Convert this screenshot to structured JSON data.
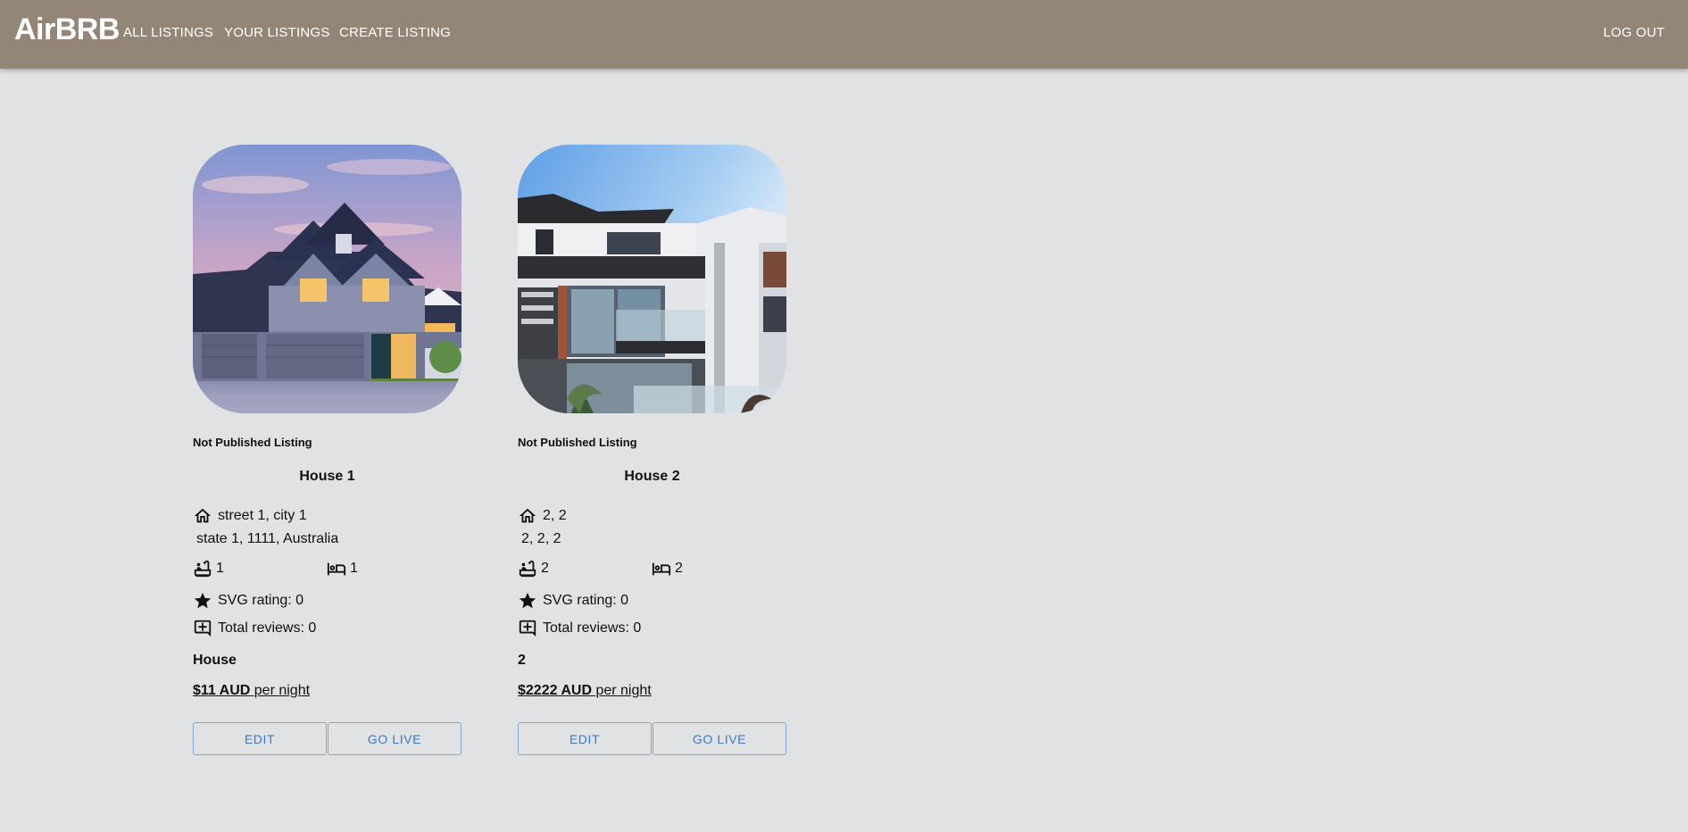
{
  "header": {
    "brand": "AirBRB",
    "nav": {
      "all_listings": "ALL LISTINGS",
      "your_listings": "YOUR LISTINGS",
      "create_listing": "CREATE LISTING",
      "logout": "LOG OUT"
    },
    "background": "#948677"
  },
  "listings": [
    {
      "status": "Not Published Listing",
      "title": "House 1",
      "address_line1": "street 1, city 1",
      "address_line2": "state 1, 1111, Australia",
      "bathrooms": "1",
      "bedrooms": "1",
      "rating_label": "SVG rating: 0",
      "reviews_label": "Total reviews: 0",
      "property_type": "House",
      "price_amount": "$11 AUD",
      "price_suffix": " per night",
      "edit_label": "EDIT",
      "go_live_label": "GO LIVE",
      "image": "suburban-house-photo"
    },
    {
      "status": "Not Published Listing",
      "title": "House 2",
      "address_line1": "2, 2",
      "address_line2": "2, 2, 2",
      "bathrooms": "2",
      "bedrooms": "2",
      "rating_label": "SVG rating: 0",
      "reviews_label": "Total reviews: 0",
      "property_type": "2",
      "price_amount": "$2222 AUD",
      "price_suffix": " per night",
      "edit_label": "EDIT",
      "go_live_label": "GO LIVE",
      "image": "modern-building-photo"
    }
  ],
  "colors": {
    "page_bg": "#e1e2e4",
    "button_accent": "#3d79c8"
  }
}
